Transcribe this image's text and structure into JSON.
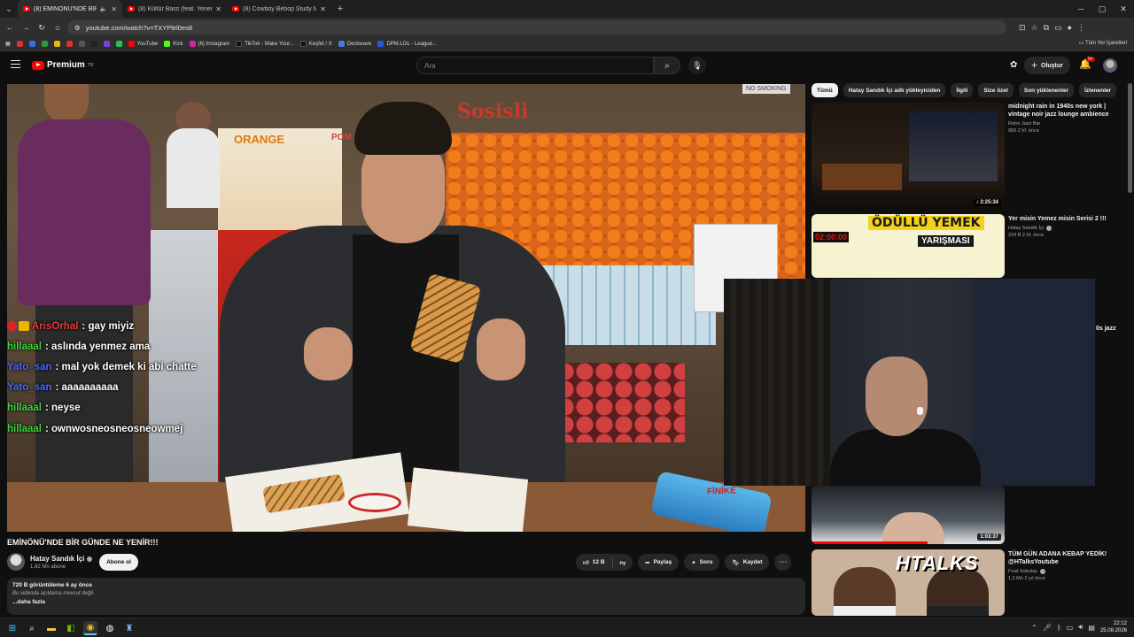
{
  "browser": {
    "tabs": [
      {
        "title": "(8) EMİNÖNÜ'NDE BİR GÜ",
        "active": true
      },
      {
        "title": "(8) Kültür Bass (feat. Yener Çevik",
        "active": false
      },
      {
        "title": "(8) Cowboy Bebop Study Music",
        "active": false
      }
    ],
    "url": "youtube.com/watch?v=TXYPlel0es8",
    "bookmarks": [
      {
        "label": "",
        "color": "#e03030"
      },
      {
        "label": "",
        "color": "#3b6fe0"
      },
      {
        "label": "",
        "color": "#2a9a3a"
      },
      {
        "label": "",
        "color": "#e8b810"
      },
      {
        "label": "",
        "color": "#e03030"
      },
      {
        "label": "",
        "color": "#555555"
      },
      {
        "label": "",
        "color": "#222222"
      },
      {
        "label": "",
        "color": "#7b3fe0"
      },
      {
        "label": "",
        "color": "#30c050"
      },
      {
        "label": "YouTube",
        "color": "#ff0000"
      },
      {
        "label": "Kick",
        "color": "#53fc18"
      },
      {
        "label": "(6) Instagram",
        "color": "#d6249f"
      },
      {
        "label": "TikTok - Make Your...",
        "color": "#111111"
      },
      {
        "label": "Keşfet / X",
        "color": "#111111"
      },
      {
        "label": "Deckwave",
        "color": "#4a7ae0"
      },
      {
        "label": "DPM.LOL - League...",
        "color": "#2a5ae0"
      }
    ],
    "all_bookmarks": "Tüm Yer İşaretleri"
  },
  "youtube": {
    "logo_text": "Premium",
    "logo_sup": "TR",
    "search_placeholder": "Ara",
    "create_label": "Oluştur",
    "notif_count": "9+"
  },
  "video": {
    "title": "EMİNÖNÜ'NDE BİR GÜNDE NE YENİR!!!",
    "channel": "Hatay Sandık İçi",
    "subscribers": "1,82 Mn abone",
    "subscribe_label": "Abone ol",
    "likes": "12 B",
    "share_label": "Paylaş",
    "ask_label": "Soru",
    "save_label": "Kaydet",
    "views_date": "720 B görüntüleme  6 ay önce",
    "description": "Bu videoda açıklama mevcut değil.",
    "more_label": "...daha fazla",
    "scene_sign": "Sosisli",
    "orange_sign": "ORANGE",
    "pom_sign": "POM",
    "no_smoking": "NO SMOKING",
    "finike": "FİNİKE"
  },
  "chat": [
    {
      "user": "ArisOrhal",
      "color": "#e63b3b",
      "msg": ": gay miyiz",
      "badge": true
    },
    {
      "user": "hillaaal",
      "color": "#3fd63f",
      "msg": ": aslında yenmez ama",
      "badge": false
    },
    {
      "user": "Yato_san",
      "color": "#4a6aff",
      "msg": ": mal yok demek ki abi chatte",
      "badge": false
    },
    {
      "user": "Yato_san",
      "color": "#4a6aff",
      "msg": ": aaaaaaaaaa",
      "badge": false
    },
    {
      "user": "hillaaal",
      "color": "#3fd63f",
      "msg": ": neyse",
      "badge": false
    },
    {
      "user": "hillaaal",
      "color": "#3fd63f",
      "msg": ": ownwosneosneosneowmej",
      "badge": false
    }
  ],
  "filters": [
    "Tümü",
    "Hatay Sandık İçi adlı yükleyiciden",
    "İlgili",
    "Size özel",
    "Son yüklenenler",
    "İzlenenler"
  ],
  "recommendations": [
    {
      "title": "midnight rain in 1940s new york | vintage noir jazz lounge ambience",
      "channel": "Retro Jazz Bar",
      "meta": "900  2 hf. önce",
      "duration": "2:25:34",
      "verified": false
    },
    {
      "title": "Yer misin Yemez misin Serisi 2 !!!",
      "channel": "Hatay Sandık İçi",
      "meta": "224 B  2 hf. önce",
      "duration": "",
      "verified": true,
      "banner": "ÖDÜLLÜ YEMEK",
      "banner2": "YARIŞMASI",
      "timer": "02:00:00"
    },
    {
      "title": "",
      "channel": "",
      "meta": "",
      "duration": "1:03:37",
      "verified": false
    },
    {
      "title": "TÜM GÜN ADANA KEBAP YEDİK! @HTalksYoutube",
      "channel": "Fırat Sobutay",
      "meta": "1,2 Mn  2 yıl önce",
      "duration": "",
      "verified": true,
      "banner": "HTALKS"
    }
  ],
  "cutoff_text": "0s jazz",
  "taskbar": {
    "time": "22:12",
    "date": "25.08.2026"
  }
}
